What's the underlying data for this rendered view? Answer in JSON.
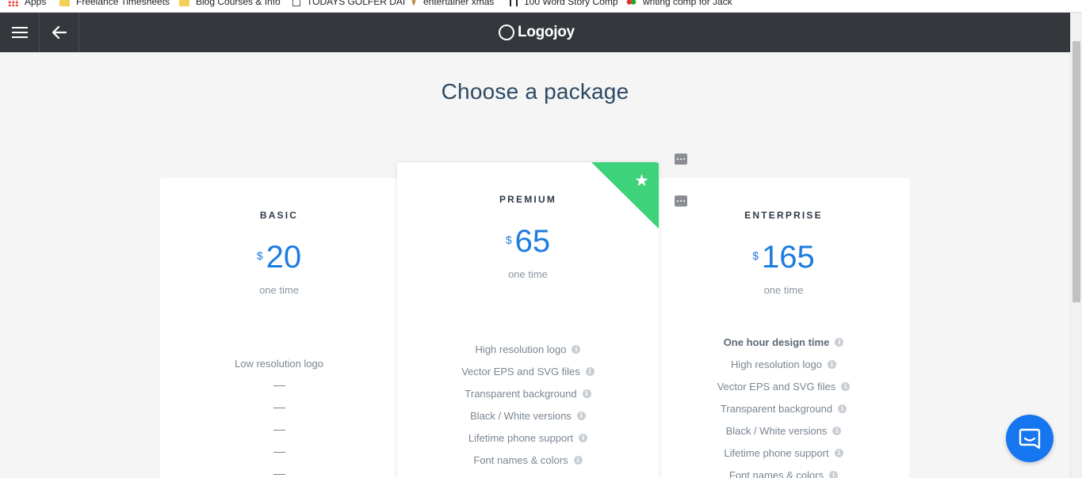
{
  "bookmarks": [
    {
      "label": "Apps",
      "icon": "apps-grid-icon"
    },
    {
      "label": "Freelance Timesheets",
      "icon": "folder-icon"
    },
    {
      "label": "Blog Courses & Info",
      "icon": "folder-icon"
    },
    {
      "label": "TODAYS GOLFER DAI",
      "icon": "page-icon"
    },
    {
      "label": "entertainer xmas",
      "icon": "entertainer-icon"
    },
    {
      "label": "100 Word Story Comp",
      "icon": "hundred-word-icon"
    },
    {
      "label": "writing comp for Jack",
      "icon": "writing-comp-icon"
    }
  ],
  "header": {
    "brand": "Logojoy",
    "menu_icon": "hamburger-icon",
    "back_icon": "arrow-left-icon",
    "background": "#34383d"
  },
  "page": {
    "title": "Choose a package"
  },
  "plans": [
    {
      "name": "BASIC",
      "currency": "$",
      "price": "20",
      "period": "one time",
      "features": [
        "Low resolution logo",
        "—",
        "—",
        "—",
        "—",
        "—"
      ]
    },
    {
      "name": "PREMIUM",
      "currency": "$",
      "price": "65",
      "period": "one time",
      "featured": true,
      "ribbon_icon": "star-icon",
      "features": [
        "High resolution logo",
        "Vector EPS and SVG files",
        "Transparent background",
        "Black / White versions",
        "Lifetime phone support",
        "Font names & colors",
        ""
      ]
    },
    {
      "name": "ENTERPRISE",
      "currency": "$",
      "price": "165",
      "period": "one time",
      "features": [
        "One hour design time",
        "High resolution logo",
        "Vector EPS and SVG files",
        "Transparent background",
        "Black / White versions",
        "Lifetime phone support",
        "Font names & colors"
      ]
    }
  ],
  "info_icon": "i",
  "colors": {
    "accent": "#1d7ce0",
    "ribbon": "#3ed27a",
    "chat": "#1676f0",
    "title": "#2d4a64"
  },
  "chat": {
    "icon": "chat-bubble-icon"
  },
  "overlay_icons": [
    "more-dots-icon",
    "more-dots-icon"
  ]
}
